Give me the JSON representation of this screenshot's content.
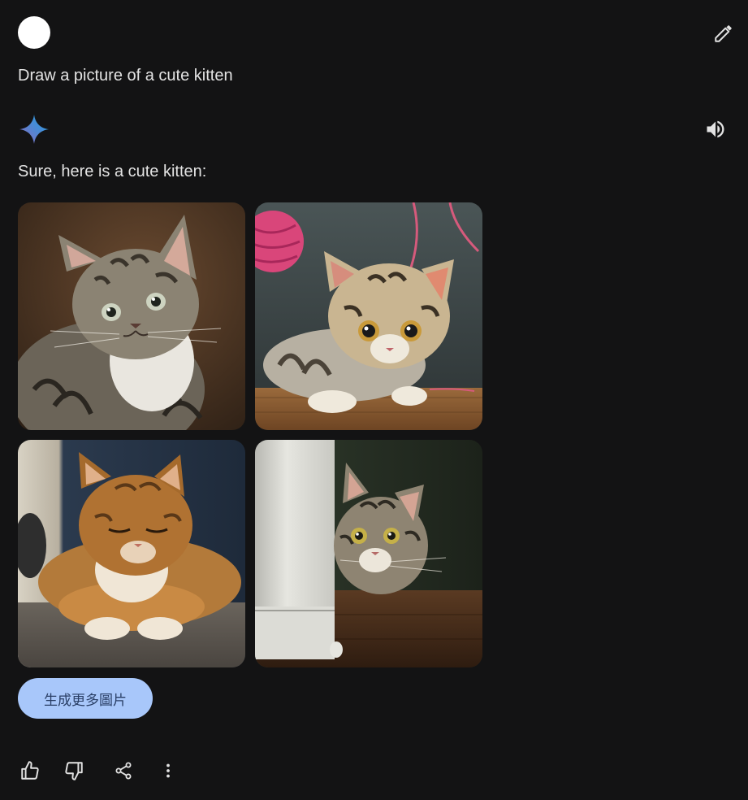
{
  "user": {
    "avatar_icon": "user-avatar",
    "prompt": "Draw a picture of a cute kitten",
    "edit_icon": "pencil-icon"
  },
  "reply": {
    "logo_icon": "gemini-sparkle-icon",
    "listen_icon": "speaker-icon",
    "text": "Sure, here is a cute kitten:"
  },
  "images": [
    {
      "icon": "tabby-kitten-photo"
    },
    {
      "icon": "kitten-with-yarn-photo"
    },
    {
      "icon": "sleeping-fluffy-cat-photo"
    },
    {
      "icon": "kitten-peeking-behind-curtain-photo"
    }
  ],
  "generate_more": "生成更多圖片",
  "actions": {
    "like_icon": "thumbs-up-icon",
    "dislike_icon": "thumbs-down-icon",
    "share_icon": "share-icon",
    "more_icon": "more-vert-icon"
  },
  "colors": {
    "background": "#131314",
    "text": "#e3e3e3",
    "button_bg": "#a8c7fa",
    "button_text": "#2a3f66"
  }
}
